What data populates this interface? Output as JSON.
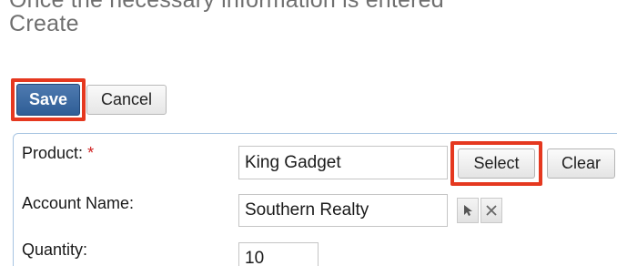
{
  "cut_off_text": "Once the necessary information is entered",
  "page_title": "Create",
  "toolbar": {
    "save_label": "Save",
    "cancel_label": "Cancel"
  },
  "form": {
    "product": {
      "label": "Product:",
      "required_marker": "*",
      "value": "King Gadget",
      "select_label": "Select",
      "clear_label": "Clear"
    },
    "account_name": {
      "label": "Account Name:",
      "value": "Southern Realty",
      "select_icon": "arrow-cursor-icon",
      "clear_icon": "x-icon"
    },
    "quantity": {
      "label": "Quantity:",
      "value": "10"
    }
  },
  "colors": {
    "highlight": "#e5381f",
    "save_button": "#2f5e96",
    "panel_border": "#a8c5e2",
    "required": "#d02020"
  }
}
